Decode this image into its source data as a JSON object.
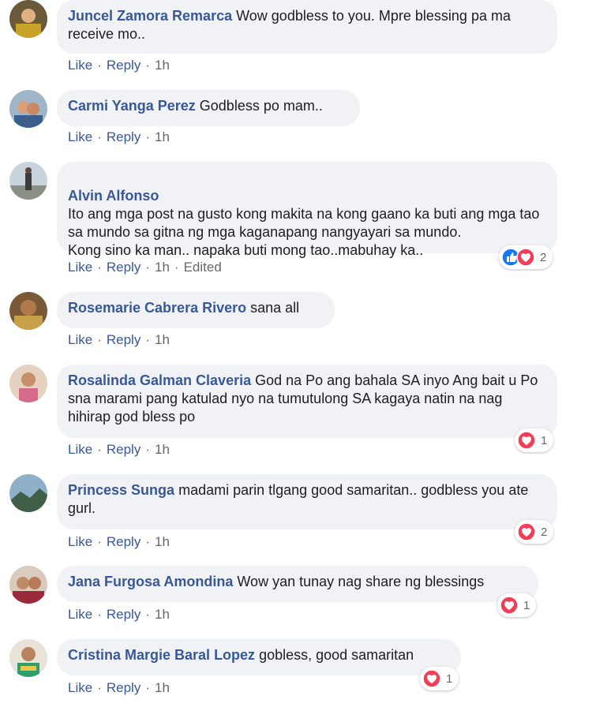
{
  "actions": {
    "like": "Like",
    "reply": "Reply",
    "sep": "·"
  },
  "colors": {
    "author": "#385898",
    "bubble": "#f0f2f5",
    "like_blue": "#1877f2",
    "love_red": "#f33e58"
  },
  "comments": [
    {
      "author": "Juncel Zamora Remarca",
      "text": "Wow godbless to you. Mpre blessing pa ma receive mo..",
      "time": "1h",
      "edited": "",
      "reactions": null
    },
    {
      "author": "Carmi Yanga Perez",
      "text": "Godbless po mam..",
      "time": "1h",
      "edited": "",
      "reactions": null
    },
    {
      "author": "Alvin Alfonso",
      "text": "Ito ang mga post na gusto kong makita na kong gaano ka buti ang mga tao sa mundo sa gitna ng mga kaganapang nangyayari sa mundo.\nKong sino ka man.. napaka buti mong tao..mabuhay ka..",
      "time": "1h",
      "edited": "Edited",
      "reactions": {
        "icons": [
          "like-icon",
          "love-icon"
        ],
        "count": "2"
      }
    },
    {
      "author": "Rosemarie Cabrera Rivero",
      "text": "sana all",
      "time": "1h",
      "edited": "",
      "reactions": null
    },
    {
      "author": "Rosalinda Galman Claveria",
      "text": "God na Po ang bahala SA inyo Ang bait u Po sna marami pang katulad nyo na tumutulong SA kagaya natin na nag hihirap god bless po",
      "time": "1h",
      "edited": "",
      "reactions": {
        "icons": [
          "love-icon"
        ],
        "count": "1"
      }
    },
    {
      "author": "Princess Sunga",
      "text": "madami parin tlgang good samaritan.. godbless you ate gurl.",
      "time": "1h",
      "edited": "",
      "reactions": {
        "icons": [
          "love-icon"
        ],
        "count": "2"
      }
    },
    {
      "author": "Jana Furgosa Amondina",
      "text": "Wow yan tunay nag share ng blessings",
      "time": "1h",
      "edited": "",
      "reactions": {
        "icons": [
          "love-icon"
        ],
        "count": "1"
      }
    },
    {
      "author": "Cristina Margie Baral Lopez",
      "text": "gobless, good samaritan",
      "time": "1h",
      "edited": "",
      "reactions": {
        "icons": [
          "love-icon"
        ],
        "count": "1"
      }
    }
  ]
}
